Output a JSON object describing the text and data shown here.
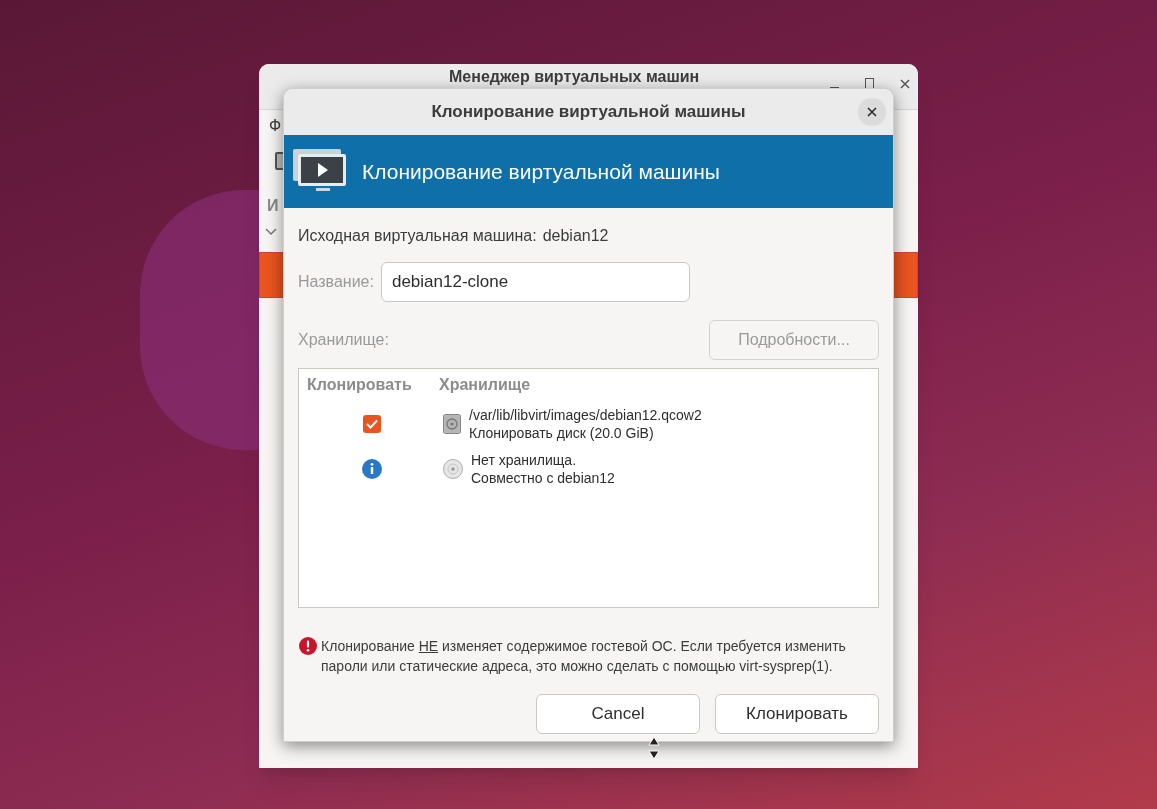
{
  "background_window": {
    "title": "Менеджер виртуальных машин",
    "menu_fragment": "Ф",
    "column_fragment": "И"
  },
  "dialog": {
    "title": "Клонирование виртуальной машины",
    "banner_title": "Клонирование виртуальной машины",
    "source_label": "Исходная виртуальная машина:",
    "source_value": "debian12",
    "name_label": "Название:",
    "name_value": "debian12-clone",
    "storage_label": "Хранилище:",
    "details_button": {
      "label": "Подробности...",
      "disabled": true
    },
    "table": {
      "columns": [
        "Клонировать",
        "Хранилище"
      ],
      "rows": [
        {
          "kind": "checkbox",
          "checked": true,
          "line1": "/var/lib/libvirt/images/debian12.qcow2",
          "line2": "Клонировать диск (20.0 GiB)"
        },
        {
          "kind": "info",
          "line1": "Нет хранилища.",
          "line2": "Совместно с debian12"
        }
      ]
    },
    "note": {
      "before": "Клонирование ",
      "underlined": "НЕ",
      "after": " изменяет содержимое гостевой ОС. Если требуется изменить пароли или статические адреса, это можно сделать с помощью virt-sysprep(1)."
    },
    "buttons": [
      "Cancel",
      "Клонировать"
    ]
  }
}
